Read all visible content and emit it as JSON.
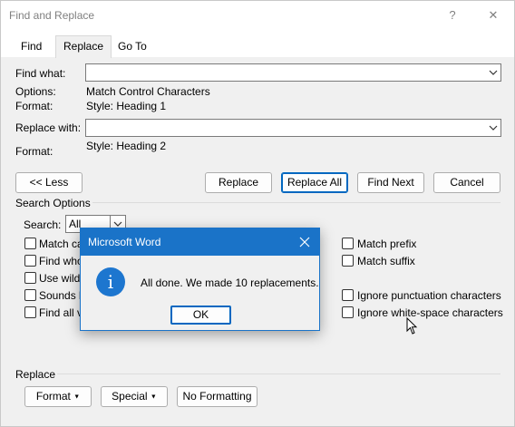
{
  "window": {
    "title": "Find and Replace",
    "help_glyph": "?",
    "close_glyph": "✕"
  },
  "tabs": [
    {
      "label": "Find"
    },
    {
      "label": "Replace"
    },
    {
      "label": "Go To"
    }
  ],
  "find": {
    "label": "Find what:",
    "value": "",
    "options_label": "Options:",
    "options_value": "Match Control Characters",
    "format_label": "Format:",
    "format_value": "Style: Heading 1"
  },
  "replace": {
    "label": "Replace with:",
    "value": "",
    "format_label": "Format:",
    "format_value": "Style: Heading 2"
  },
  "buttons": {
    "less": "<< Less",
    "replace": "Replace",
    "replace_all": "Replace All",
    "find_next": "Find Next",
    "cancel": "Cancel"
  },
  "search_options": {
    "title": "Search Options",
    "search_label": "Search:",
    "search_value": "All",
    "left_checks": [
      "Match ca",
      "Find who",
      "Use wildc",
      "Sounds l",
      "Find all v"
    ],
    "right_checks": [
      "Match prefix",
      "Match suffix",
      "Ignore punctuation characters",
      "Ignore white-space characters"
    ]
  },
  "replace_section": {
    "title": "Replace",
    "format_btn": "Format",
    "special_btn": "Special",
    "no_formatting_btn": "No Formatting"
  },
  "message_box": {
    "title": "Microsoft Word",
    "text": "All done. We made 10 replacements.",
    "ok": "OK",
    "icon_glyph": "i"
  },
  "colors": {
    "accent": "#1a73c8",
    "focus_border": "#0067c0"
  }
}
